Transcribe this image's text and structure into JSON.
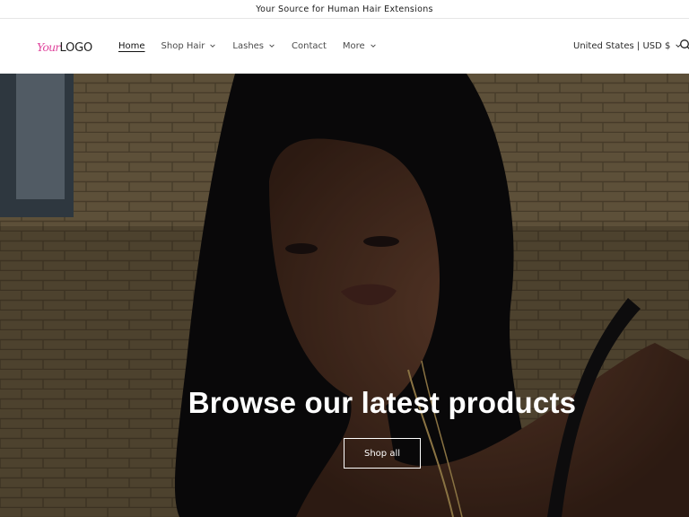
{
  "announcement": {
    "text": "Your Source for Human Hair Extensions"
  },
  "header": {
    "logo": {
      "script": "Your",
      "bold": "LOGO"
    },
    "nav": [
      {
        "label": "Home",
        "active": true,
        "dropdown": false
      },
      {
        "label": "Shop Hair",
        "active": false,
        "dropdown": true
      },
      {
        "label": "Lashes",
        "active": false,
        "dropdown": true
      },
      {
        "label": "Contact",
        "active": false,
        "dropdown": false
      },
      {
        "label": "More",
        "active": false,
        "dropdown": true
      }
    ],
    "locale": "United States | USD $",
    "search_icon": "search-icon"
  },
  "hero": {
    "title": "Browse our latest products",
    "button_label": "Shop all"
  },
  "colors": {
    "logo_script": "#e0479e",
    "text": "#121212",
    "hero_text": "#ffffff"
  }
}
